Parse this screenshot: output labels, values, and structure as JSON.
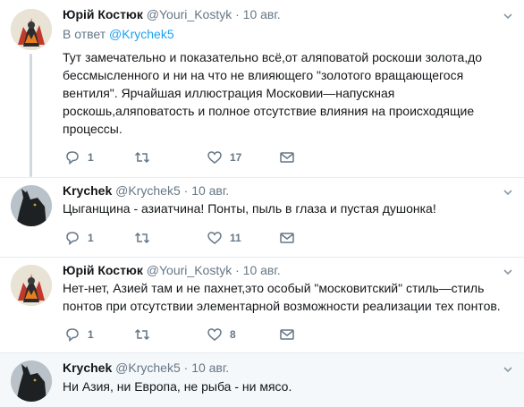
{
  "tweets": [
    {
      "name": "Юрій Костюк",
      "handle": "@Youri_Kostyk",
      "dot": "·",
      "time": "10 авг.",
      "reply_prefix": "В ответ",
      "reply_mention": "@Krychek5",
      "text": "Тут замечательно и показательно всё,от аляповатой роскоши золота,до бессмысленного и ни на что не влияющего \"золотого вращающегося вентиля\". Ярчайшая иллюстрация Московии—напускная роскошь,аляповатость и полное отсутствие влияния на происходящие процессы.",
      "replies": "1",
      "retweets": "",
      "likes": "17"
    },
    {
      "name": "Krychek",
      "handle": "@Krychek5",
      "dot": "·",
      "time": "10 авг.",
      "text": "Цыганщина - азиатчина! Понты, пыль в глаза и пустая душонка!",
      "replies": "1",
      "retweets": "",
      "likes": "11"
    },
    {
      "name": "Юрій Костюк",
      "handle": "@Youri_Kostyk",
      "dot": "·",
      "time": "10 авг.",
      "text": "Нет-нет, Азией там и не пахнет,это особый \"московитский\" стиль—стиль понтов при отсутствии элементарной возможности реализации тех понтов.",
      "replies": "1",
      "retweets": "",
      "likes": "8"
    },
    {
      "name": "Krychek",
      "handle": "@Krychek5",
      "dot": "·",
      "time": "10 авг.",
      "text": "Ни Азия, ни Европа, не рыба - ни мясо."
    }
  ],
  "icons": {
    "reply": "reply-icon",
    "retweet": "retweet-icon",
    "like": "heart-icon",
    "dm": "envelope-icon",
    "caret": "chevron-down-icon"
  },
  "colors": {
    "link": "#1da1f2",
    "secondary_text": "#657786",
    "highlight_bg": "#f5f8fa"
  }
}
